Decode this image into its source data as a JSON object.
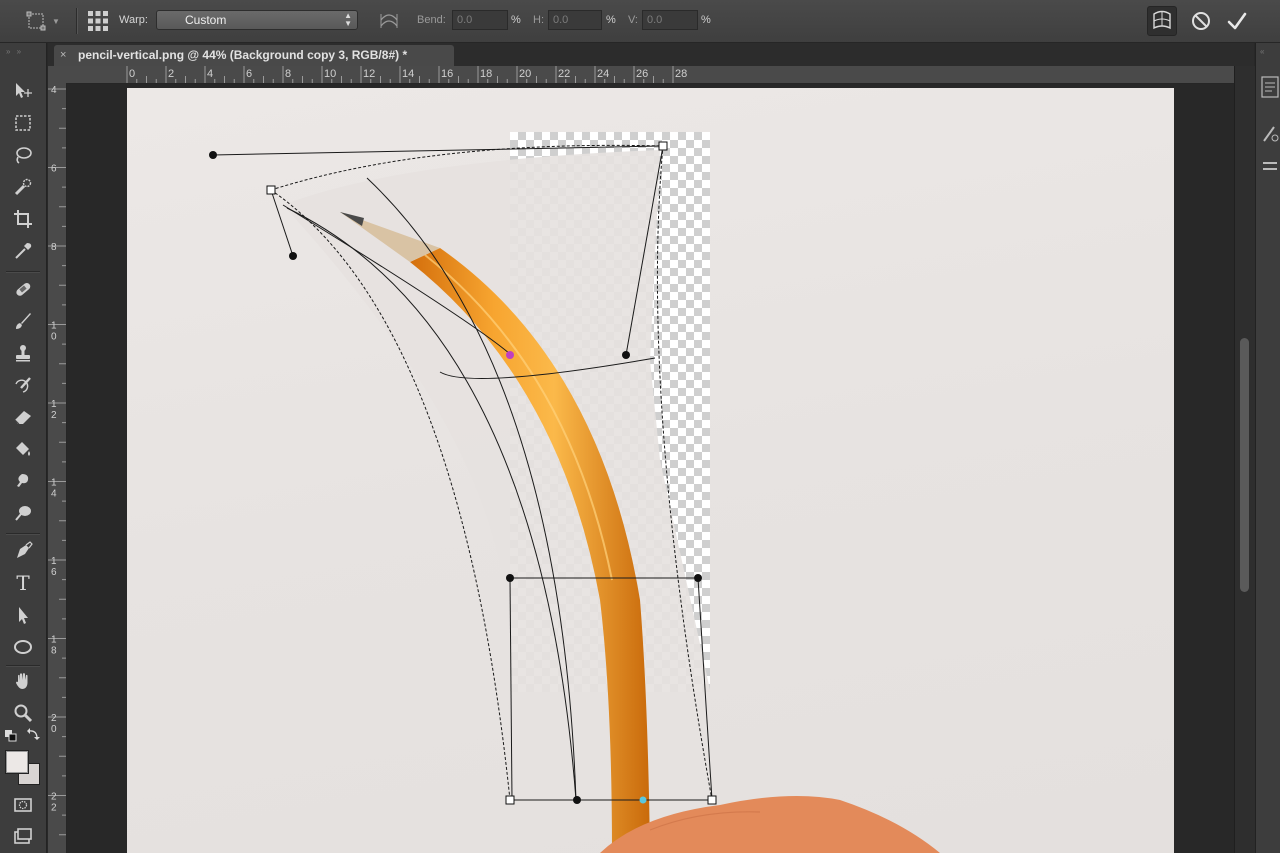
{
  "options_bar": {
    "warp_label": "Warp:",
    "warp_value": "Custom",
    "bend_label": "Bend:",
    "bend_value": "0.0",
    "h_label": "H:",
    "h_value": "0.0",
    "v_label": "V:",
    "v_value": "0.0",
    "percent": "%"
  },
  "document": {
    "tab_title": "pencil-vertical.png @ 44% (Background copy 3, RGB/8#) *",
    "close_glyph": "×"
  },
  "rulers": {
    "horizontal_ticks": [
      "0",
      "2",
      "4",
      "6",
      "8",
      "10",
      "12",
      "14",
      "16",
      "18",
      "20",
      "22",
      "24",
      "26",
      "28"
    ],
    "vertical_ticks": [
      "4",
      "6",
      "8",
      "10",
      "12",
      "14",
      "16",
      "18",
      "20",
      "22"
    ]
  },
  "toolbar": {
    "tools": [
      "move-tool",
      "rectangular-marquee-tool",
      "lasso-tool",
      "quick-selection-tool",
      "crop-tool",
      "eyedropper-tool",
      "spot-healing-brush-tool",
      "brush-tool",
      "clone-stamp-tool",
      "history-brush-tool",
      "eraser-tool",
      "paint-bucket-tool",
      "blur-tool",
      "dodge-tool",
      "pen-tool",
      "type-tool",
      "path-selection-tool",
      "ellipse-tool",
      "hand-tool",
      "zoom-tool"
    ],
    "type_glyph": "T"
  },
  "colors": {
    "foreground": "#ece8e6",
    "background": "#d8d4d2",
    "pencil": "#f09a1e",
    "hand": "#e2895a"
  }
}
